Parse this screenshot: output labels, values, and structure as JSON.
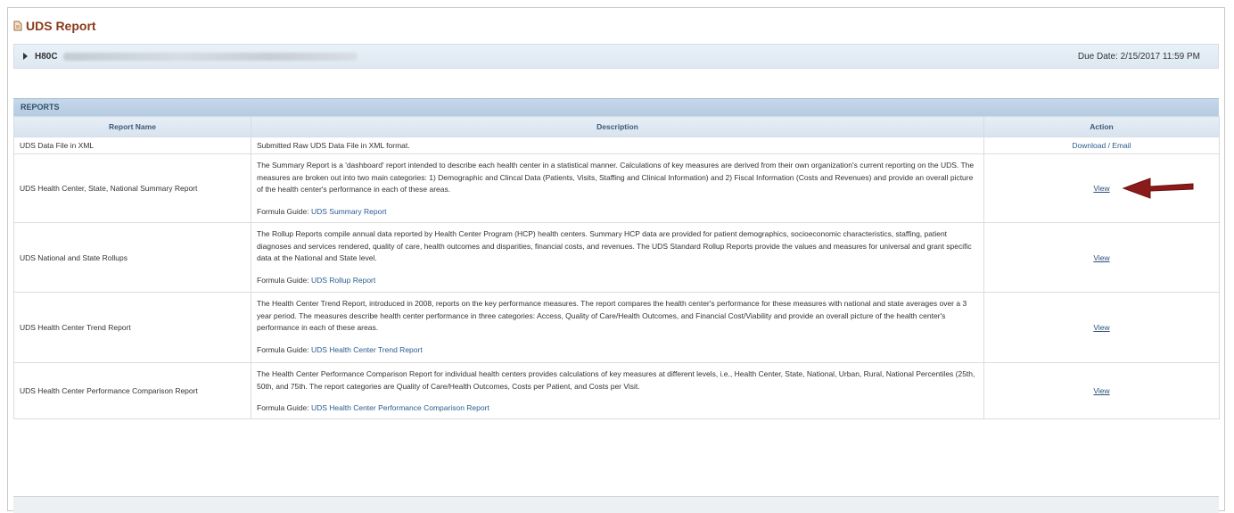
{
  "page": {
    "title": "UDS Report",
    "title_icon": "document-icon"
  },
  "org_bar": {
    "code": "H80C",
    "due_date": "Due Date: 2/15/2017 11:59 PM"
  },
  "reports": {
    "section_label": "REPORTS",
    "columns": [
      "Report Name",
      "Description",
      "Action"
    ],
    "rows": [
      {
        "name": "UDS Data File in XML",
        "description": "Submitted Raw UDS Data File in XML format.",
        "formula_prefix": "",
        "formula_link": "",
        "action": "Download / Email"
      },
      {
        "name": "UDS Health Center, State, National Summary Report",
        "description": "The Summary Report is a 'dashboard' report intended to describe each health center in a statistical manner. Calculations of key measures are derived from their own organization's current reporting on the UDS. The measures are broken out into two main categories: 1) Demographic and Clincal Data (Patients, Visits, Staffing and Clinical Information) and 2) Fiscal Information (Costs and Revenues) and provide an overall picture of the health center's performance in each of these areas.",
        "formula_prefix": "Formula Guide:",
        "formula_link": "UDS Summary Report",
        "action": "View"
      },
      {
        "name": "UDS National and State Rollups",
        "description": "The Rollup Reports compile annual data reported by Health Center Program (HCP) health centers. Summary HCP data are provided for patient demographics, socioeconomic characteristics, staffing, patient diagnoses and services rendered, quality of care, health outcomes and disparities, financial costs, and revenues. The UDS Standard Rollup Reports provide the values and measures for universal and grant specific data at the National and State level.",
        "formula_prefix": "Formula Guide:",
        "formula_link": "UDS Rollup Report",
        "action": "View"
      },
      {
        "name": "UDS Health Center Trend Report",
        "description": "The Health Center Trend Report, introduced in 2008, reports on the key performance measures. The report compares the health center's performance for these measures with national and state averages over a 3 year period. The measures describe health center performance in three categories: Access, Quality of Care/Health Outcomes, and Financial Cost/Viability and provide an overall picture of the health center's performance in each of these areas.",
        "formula_prefix": "Formula Guide:",
        "formula_link": "UDS Health Center Trend Report",
        "action": "View"
      },
      {
        "name": "UDS Health Center Performance Comparison Report",
        "description": "The Health Center Performance Comparison Report for individual health centers provides calculations of key measures at different levels, i.e., Health Center, State, National, Urban, Rural, National Percentiles (25th, 50th, and 75th. The report categories are Quality of Care/Health Outcomes, Costs per Patient, and Costs per Visit.",
        "formula_prefix": "Formula Guide:",
        "formula_link": "UDS Health Center Performance Comparison Report",
        "action": "View"
      }
    ]
  },
  "annotation": {
    "arrow_icon": "red-arrow-icon",
    "arrow_color": "#8b1a1a"
  }
}
